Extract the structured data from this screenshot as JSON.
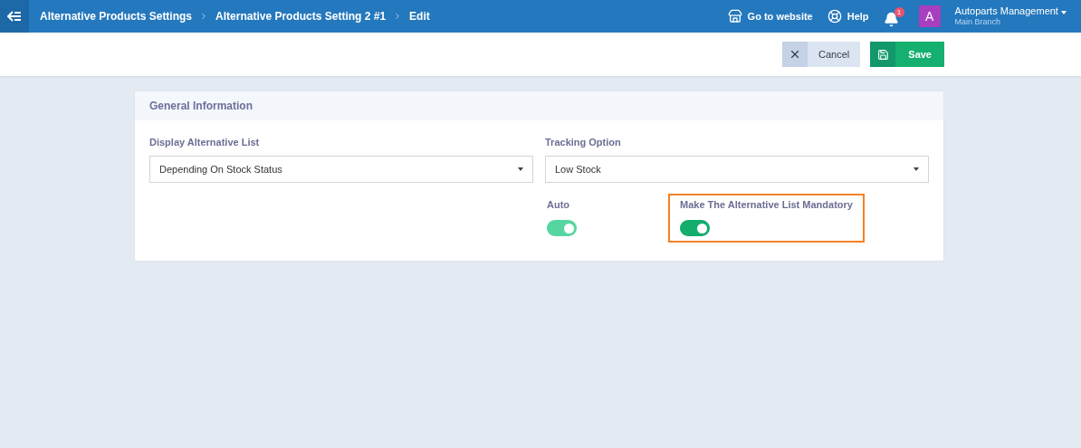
{
  "breadcrumbs": [
    {
      "label": "Alternative Products Settings"
    },
    {
      "label": "Alternative Products Setting 2 #1"
    },
    {
      "label": "Edit"
    }
  ],
  "header": {
    "website_link": "Go to website",
    "help_link": "Help",
    "notification_count": "1",
    "account": {
      "avatar_letter": "A",
      "name": "Autoparts Management",
      "branch": "Main Branch"
    }
  },
  "actions": [
    {
      "kind": "cancel",
      "label": "Cancel"
    },
    {
      "kind": "save",
      "label": "Save"
    }
  ],
  "section": {
    "title": "General Information",
    "selects": [
      {
        "label": "Display Alternative List",
        "value": "Depending On Stock Status"
      },
      {
        "label": "Tracking Option",
        "value": "Low Stock"
      }
    ],
    "toggles": [
      {
        "label": "Auto",
        "on": true,
        "disabled": true,
        "highlighted": false
      },
      {
        "label": "Make The Alternative List Mandatory",
        "on": true,
        "disabled": false,
        "highlighted": true
      }
    ]
  }
}
